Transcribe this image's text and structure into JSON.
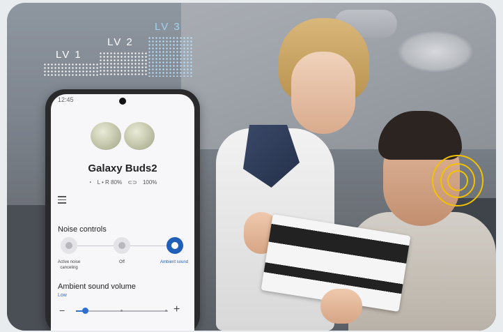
{
  "levels": [
    {
      "label": "LV 1"
    },
    {
      "label": "LV 2"
    },
    {
      "label": "LV 3"
    }
  ],
  "phone": {
    "status_time": "12:45",
    "device_name": "Galaxy Buds2",
    "battery_buds": "L • R 80%",
    "battery_case": "100%",
    "noise_controls": {
      "title": "Noise controls",
      "options": [
        {
          "label": "Active noise canceling",
          "selected": false
        },
        {
          "label": "Off",
          "selected": false
        },
        {
          "label": "Ambient sound",
          "selected": true
        }
      ]
    },
    "ambient": {
      "title": "Ambient sound volume",
      "level_label": "Low",
      "level": 0.1,
      "minus": "−",
      "plus": "+"
    }
  },
  "colors": {
    "accent": "#1f5fb8",
    "highlight_rings": "#f2c200"
  }
}
